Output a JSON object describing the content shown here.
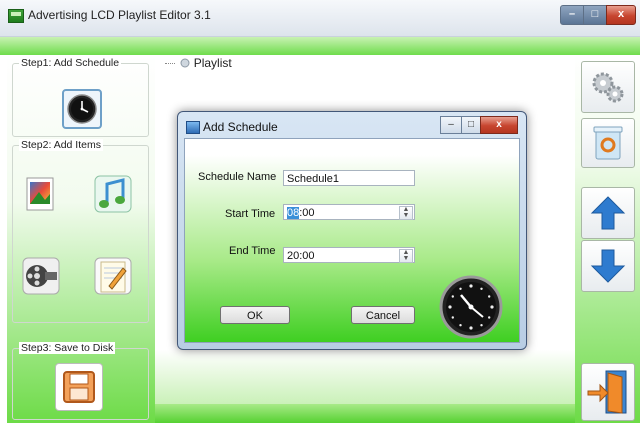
{
  "window": {
    "title": "Advertising LCD Playlist Editor 3.1",
    "min": "–",
    "max": "□",
    "close": "x"
  },
  "steps": {
    "step1": "Step1: Add Schedule",
    "step2": "Step2: Add Items",
    "step3": "Step3: Save to Disk"
  },
  "tree": {
    "root": "Playlist"
  },
  "dialog": {
    "title": "Add Schedule",
    "schedule_name_label": "Schedule Name",
    "schedule_name_value": "Schedule1",
    "start_time_label": "Start Time",
    "start_time_hour": "08",
    "start_time_rest": ":00",
    "end_time_label": "End Time",
    "end_time_value": "20:00",
    "ok_label": "OK",
    "cancel_label": "Cancel"
  },
  "colors": {
    "accent_green": "#56d132",
    "title_blue": "#5b7595"
  },
  "icons": [
    "app-icon",
    "clock-icon",
    "image-icon",
    "music-icon",
    "video-icon",
    "text-icon",
    "save-icon",
    "settings-icon",
    "trash-icon",
    "arrow-up-icon",
    "arrow-down-icon",
    "exit-door-icon",
    "playlist-node-icon"
  ]
}
